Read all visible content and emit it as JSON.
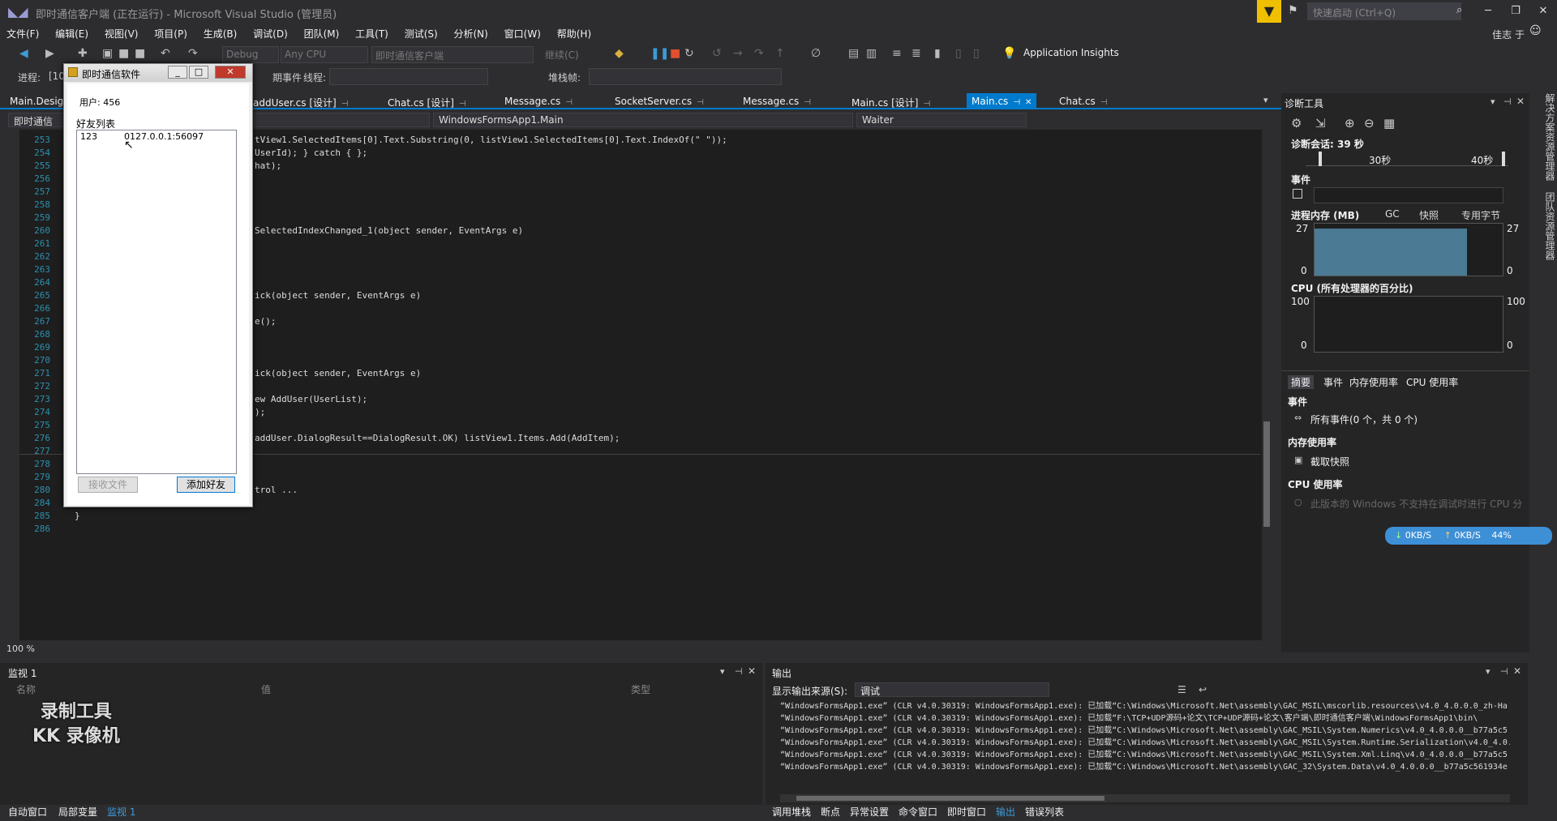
{
  "window": {
    "title": "即时通信客户端 (正在运行) - Microsoft Visual Studio (管理员)",
    "quick_launch_placeholder": "快速启动 (Ctrl+Q)",
    "user": "佳志 于"
  },
  "menu": [
    "文件(F)",
    "编辑(E)",
    "视图(V)",
    "项目(P)",
    "生成(B)",
    "调试(D)",
    "团队(M)",
    "工具(T)",
    "测试(S)",
    "分析(N)",
    "窗口(W)",
    "帮助(H)"
  ],
  "toolbar": {
    "config": "Debug",
    "platform": "Any CPU",
    "startup": "即时通信客户端",
    "continue": "继续(C)",
    "application_insights": "Application Insights"
  },
  "debugbar": {
    "process_label": "进程:",
    "process_value": "[10",
    "events_label": "期事件",
    "thread_label": "线程:",
    "stack_label": "堆栈帧:"
  },
  "tabs": [
    {
      "label": "Main.Desig",
      "active": false
    },
    {
      "label": "addUser.cs [设计]",
      "active": false
    },
    {
      "label": "Chat.cs [设计]",
      "active": false
    },
    {
      "label": "Message.cs",
      "active": false
    },
    {
      "label": "SocketServer.cs",
      "active": false
    },
    {
      "label": "Message.cs",
      "active": false
    },
    {
      "label": "Main.cs [设计]",
      "active": false
    },
    {
      "label": "Main.cs",
      "active": true
    },
    {
      "label": "Chat.cs",
      "active": false
    }
  ],
  "navbar": {
    "project": "即时通信",
    "class": "WindowsFormsApp1.Main",
    "member": "Waiter"
  },
  "editor": {
    "zoom": "100 %",
    "lines": [
      {
        "n": "253",
        "code": "tView1.SelectedItems[0].Text.Substring(0, listView1.SelectedItems[0].Text.IndexOf(\" \"));"
      },
      {
        "n": "254",
        "code": "UserId); } catch { };"
      },
      {
        "n": "255",
        "code": "hat);"
      },
      {
        "n": "256",
        "code": ""
      },
      {
        "n": "257",
        "code": ""
      },
      {
        "n": "258",
        "code": ""
      },
      {
        "n": "259",
        "code": ""
      },
      {
        "n": "260",
        "code": "SelectedIndexChanged_1(object sender, EventArgs e)"
      },
      {
        "n": "261",
        "code": ""
      },
      {
        "n": "262",
        "code": ""
      },
      {
        "n": "263",
        "code": ""
      },
      {
        "n": "264",
        "code": ""
      },
      {
        "n": "265",
        "code": "ick(object sender, EventArgs e)"
      },
      {
        "n": "266",
        "code": ""
      },
      {
        "n": "267",
        "code": "e();"
      },
      {
        "n": "268",
        "code": ""
      },
      {
        "n": "269",
        "code": ""
      },
      {
        "n": "270",
        "code": ""
      },
      {
        "n": "271",
        "code": "ick(object sender, EventArgs e)"
      },
      {
        "n": "272",
        "code": ""
      },
      {
        "n": "273",
        "code": "ew AddUser(UserList);"
      },
      {
        "n": "274",
        "code": ");"
      },
      {
        "n": "275",
        "code": ""
      },
      {
        "n": "276",
        "code": "addUser.DialogResult==DialogResult.OK) listView1.Items.Add(AddItem);"
      },
      {
        "n": "277",
        "code": ""
      },
      {
        "n": "278",
        "code": ""
      },
      {
        "n": "279",
        "code": ""
      },
      {
        "n": "280",
        "code": "trol ..."
      },
      {
        "n": "284",
        "code": ""
      },
      {
        "n": "285",
        "code": "}"
      },
      {
        "n": "286",
        "code": ""
      }
    ]
  },
  "app": {
    "title": "即时通信软件",
    "user_label": "用户: 456",
    "friends_label": "好友列表",
    "friends": [
      {
        "name": "123",
        "addr": "0127.0.0.1:56097"
      }
    ],
    "recv_button": "接收文件",
    "add_button": "添加好友"
  },
  "diagnostics": {
    "title": "诊断工具",
    "session": "诊断会话: 39 秒",
    "t30": "30秒",
    "t40": "40秒",
    "events": "事件",
    "memory": "进程内存 (MB)",
    "gc": "GC",
    "snapshot": "快照",
    "private": "专用字节",
    "mem_max": "27",
    "mem_min": "0",
    "cpu": "CPU (所有处理器的百分比)",
    "cpu_max": "100",
    "cpu_min": "0",
    "subtabs": [
      "摘要",
      "事件",
      "内存使用率",
      "CPU 使用率"
    ],
    "events_sec": "事件",
    "all_events": "所有事件(0 个，共 0 个)",
    "mem_usage": "内存使用率",
    "take_snapshot": "截取快照",
    "cpu_usage": "CPU 使用率",
    "cpu_note": "此版本的 Windows 不支持在调试时进行 CPU 分"
  },
  "side_tabs": [
    "解决方案资源管理器",
    "团队资源管理器"
  ],
  "netmeter": {
    "down": "0KB/S",
    "up": "0KB/S",
    "pct": "44%"
  },
  "watch": {
    "title": "监视 1",
    "col_name": "名称",
    "col_value": "值",
    "col_type": "类型",
    "watermark_line1": "录制工具",
    "watermark_line2": "KK 录像机"
  },
  "output": {
    "title": "输出",
    "source_label": "显示输出来源(S):",
    "source_value": "调试",
    "lines": [
      "“WindowsFormsApp1.exe” (CLR v4.0.30319: WindowsFormsApp1.exe): 已加载“C:\\Windows\\Microsoft.Net\\assembly\\GAC_MSIL\\mscorlib.resources\\v4.0_4.0.0.0_zh-Ha",
      "“WindowsFormsApp1.exe” (CLR v4.0.30319: WindowsFormsApp1.exe): 已加载“F:\\TCP+UDP源码+论文\\TCP+UDP源码+论文\\客户端\\即时通信客户端\\WindowsFormsApp1\\bin\\",
      "“WindowsFormsApp1.exe” (CLR v4.0.30319: WindowsFormsApp1.exe): 已加载“C:\\Windows\\Microsoft.Net\\assembly\\GAC_MSIL\\System.Numerics\\v4.0_4.0.0.0__b77a5c5",
      "“WindowsFormsApp1.exe” (CLR v4.0.30319: WindowsFormsApp1.exe): 已加载“C:\\Windows\\Microsoft.Net\\assembly\\GAC_MSIL\\System.Runtime.Serialization\\v4.0_4.0.",
      "“WindowsFormsApp1.exe” (CLR v4.0.30319: WindowsFormsApp1.exe): 已加载“C:\\Windows\\Microsoft.Net\\assembly\\GAC_MSIL\\System.Xml.Linq\\v4.0_4.0.0.0__b77a5c5",
      "“WindowsFormsApp1.exe” (CLR v4.0.30319: WindowsFormsApp1.exe): 已加载“C:\\Windows\\Microsoft.Net\\assembly\\GAC_32\\System.Data\\v4.0_4.0.0.0__b77a5c561934e"
    ]
  },
  "bottom_tabs_left": [
    {
      "label": "自动窗口",
      "active": false
    },
    {
      "label": "局部变量",
      "active": false
    },
    {
      "label": "监视 1",
      "active": true
    }
  ],
  "bottom_tabs_right": [
    {
      "label": "调用堆栈",
      "active": false
    },
    {
      "label": "断点",
      "active": false
    },
    {
      "label": "异常设置",
      "active": false
    },
    {
      "label": "命令窗口",
      "active": false
    },
    {
      "label": "即时窗口",
      "active": false
    },
    {
      "label": "输出",
      "active": true
    },
    {
      "label": "错误列表",
      "active": false
    }
  ]
}
